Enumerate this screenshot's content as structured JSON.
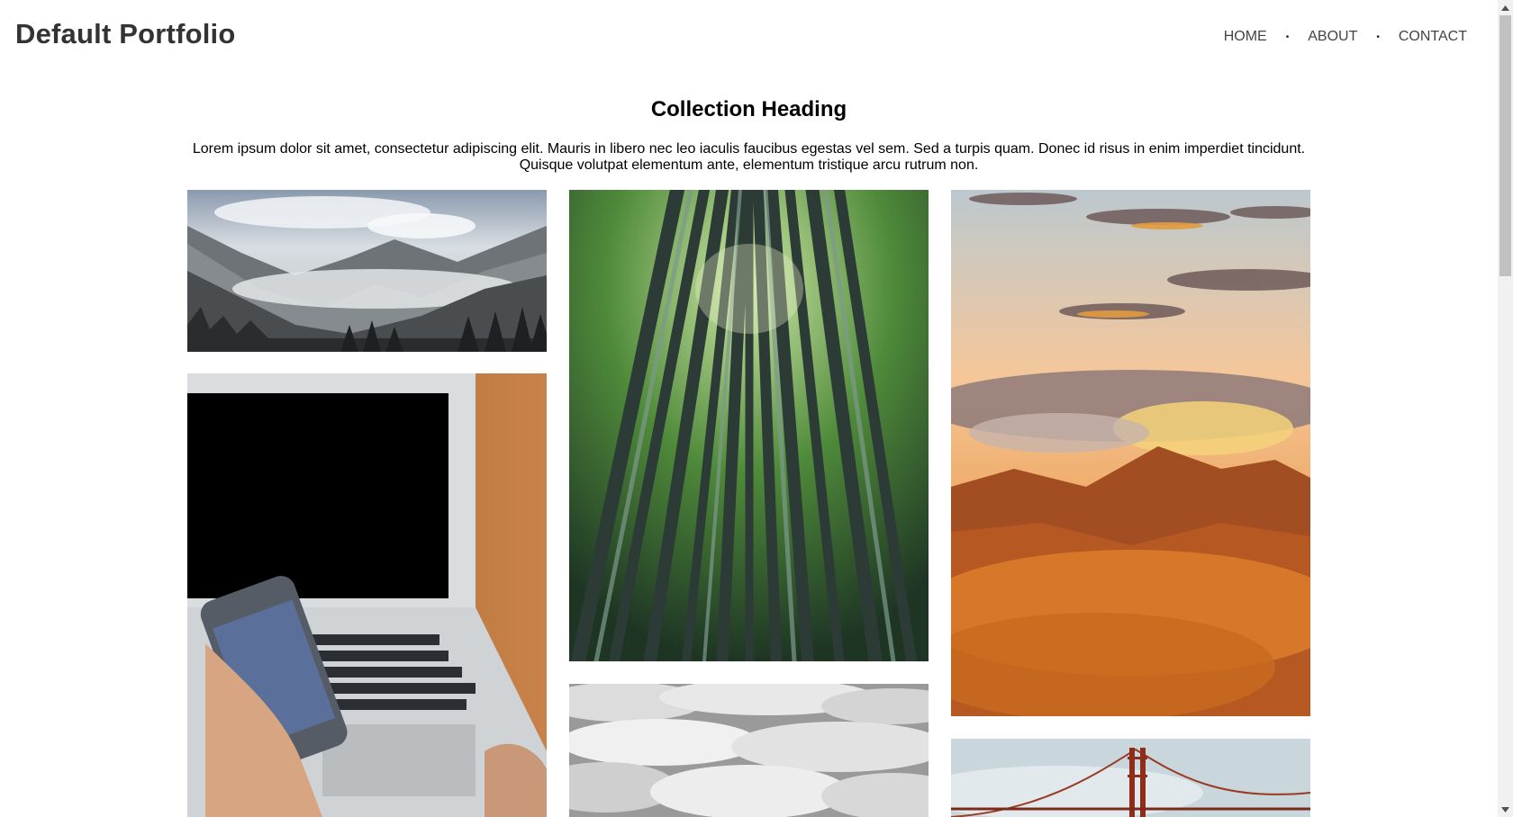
{
  "site": {
    "title": "Default Portfolio"
  },
  "nav": {
    "items": [
      "HOME",
      "ABOUT",
      "CONTACT"
    ],
    "separator": "•"
  },
  "collection": {
    "heading": "Collection Heading",
    "intro_line1": "Lorem ipsum dolor sit amet, consectetur adipiscing elit. Mauris in libero nec leo iaculis faucibus egestas vel sem. Sed a turpis quam. Donec id risus in enim imperdiet tincidunt.",
    "intro_line2": "Quisque volutpat elementum ante, elementum tristique arcu rutrum non."
  },
  "images": [
    {
      "subject": "misty-mountains"
    },
    {
      "subject": "laptop-and-phone"
    },
    {
      "subject": "bamboo-forest"
    },
    {
      "subject": "sea-of-clouds"
    },
    {
      "subject": "sunset-mountain"
    },
    {
      "subject": "golden-gate-bridge"
    }
  ],
  "colors": {
    "title": "#333333",
    "nav": "#444444",
    "scroll_track": "#f1f1f1",
    "scroll_thumb": "#c1c1c1"
  }
}
